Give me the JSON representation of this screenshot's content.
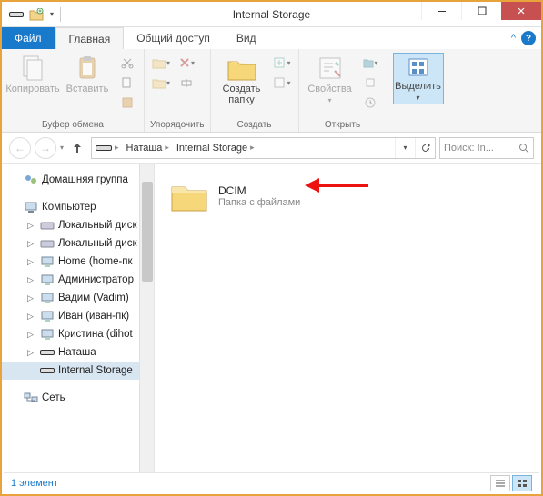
{
  "window": {
    "title": "Internal Storage"
  },
  "tabs": {
    "file": "Файл",
    "home": "Главная",
    "share": "Общий доступ",
    "view": "Вид"
  },
  "ribbon": {
    "clipboard": {
      "copy": "Копировать",
      "paste": "Вставить",
      "label": "Буфер обмена"
    },
    "organize": {
      "label": "Упорядочить"
    },
    "new": {
      "create_folder": "Создать\nпапку",
      "label": "Создать"
    },
    "open": {
      "properties": "Свойства",
      "label": "Открыть"
    },
    "select": {
      "select": "Выделить",
      "label": ""
    }
  },
  "breadcrumbs": {
    "items": [
      "Наташа",
      "Internal Storage"
    ]
  },
  "search": {
    "placeholder": "Поиск: In..."
  },
  "navpane": {
    "homegroup": "Домашняя группа",
    "computer": "Компьютер",
    "items": [
      "Локальный диск",
      "Локальный диск",
      "Home (home-пк",
      "Администратор",
      "Вадим (Vadim)",
      "Иван (иван-пк)",
      "Кристина (dihot",
      "Наташа"
    ],
    "internal_storage": "Internal Storage",
    "network": "Сеть"
  },
  "content": {
    "folder": {
      "name": "DCIM",
      "type": "Папка с файлами"
    }
  },
  "statusbar": {
    "count": "1 элемент"
  }
}
